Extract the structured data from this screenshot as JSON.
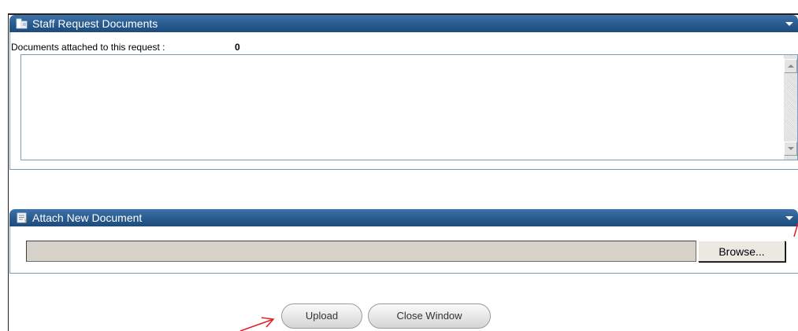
{
  "docs_panel": {
    "title": "Staff Request Documents",
    "count_label": "Documents attached to this request :",
    "count": "0",
    "header_icon": "documents-icon",
    "collapse_icon": "collapse-arrow-icon"
  },
  "attach_panel": {
    "title": "Attach New Document",
    "header_icon": "attach-document-icon",
    "collapse_icon": "collapse-arrow-icon",
    "file_value": "",
    "browse_label": "Browse..."
  },
  "actions": {
    "upload_label": "Upload",
    "close_label": "Close Window"
  },
  "colors": {
    "header_gradient_top": "#3f74a8",
    "header_gradient_bottom": "#1d4b7c",
    "annotation_arrow": "#e02020"
  }
}
